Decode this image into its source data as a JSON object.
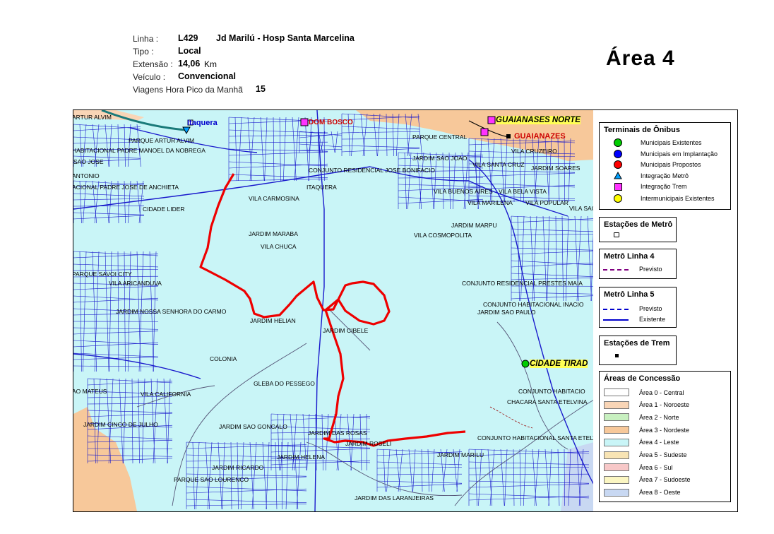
{
  "header": {
    "linha_label": "Linha :",
    "linha_code": "L429",
    "linha_name": "Jd Marilú - Hosp Santa Marcelina",
    "tipo_label": "Tipo :",
    "tipo_value": "Local",
    "extensao_label": "Extensão :",
    "extensao_value": "14,06",
    "extensao_unit": "Km",
    "veiculo_label": "Veículo :",
    "veiculo_value": "Convencional",
    "viagens_label": "Viagens Hora Pico da Manhã",
    "viagens_value": "15",
    "area_title": "Área  4"
  },
  "map": {
    "stations": {
      "itaquera": "Itaquera",
      "dom_bosco": "DOM BOSCO",
      "guaianases_norte": "GUAIANASES NORTE",
      "guaianazes": "GUAIANAZES",
      "cidade_tiradentes": "CIDADE TIRAD"
    },
    "labels": [
      "ARTUR ALVIM",
      "PARQUE ARTUR ALVIM",
      "HABITACIONAL PADRE MANOEL DA NOBREGA",
      "SAO JOSE",
      "ANTONIO",
      "ACIONAL PADRE JOSE DE ANCHIETA",
      "CIDADE LIDER",
      "VILA CARMOSINA",
      "ITAQUERA",
      "CONJUNTO RESIDENCIAL JOSE BONIFACIO",
      "PARQUE CENTRAL",
      "JARDIM SAO JOAO",
      "VILA CRUZEIRO",
      "VILA SANTA CRUZ",
      "JARDIM SOARES",
      "VILA BUENOS AIRES",
      "VILA BELA VISTA",
      "VILA MARILENA",
      "VILA POPULAR",
      "VILA SAO",
      "JARDIM MARPU",
      "VILA COSMOPOLITA",
      "JARDIM MARABA",
      "VILA CHUCA",
      "PARQUE SAVOI CITY",
      "VILA ARICANDUVA",
      "CONJUNTO RESIDENCIAL PRESTES MAIA",
      "JARDIM NOSSA SENHORA DO CARMO",
      "CONJUNTO HABITACIONAL INACIO",
      "JARDIM SAO PAULO",
      "JARDIM HELIAN",
      "JARDIM CIBELE",
      "COLONIA",
      "GLEBA DO PESSEGO",
      "AO MATEUS",
      "VILA CALIFORNIA",
      "CONJUNTO HABITACIO",
      "CHACARA SANTA ETELVINA",
      "JARDIM CINCO DE JULHO",
      "JARDIM SAO GONCALO",
      "JARDIM DAS ROSAS",
      "JARDIM ROSELI",
      "CONJUNTO HABITACIONAL SANTA ETELVINA",
      "JARDIM MARILU",
      "JARDIM HELENA",
      "JARDIM RICARDO",
      "PARQUE SAO LOURENCO",
      "JARDIM DAS LARANJEIRAS"
    ]
  },
  "legend": {
    "terminais": {
      "title": "Terminais de Ônibus",
      "items": [
        {
          "label": "Municipais Existentes",
          "color": "#00cc00"
        },
        {
          "label": "Municipais em Implantação",
          "color": "#0000ff"
        },
        {
          "label": "Municipais Propostos",
          "color": "#ff0000"
        },
        {
          "label": "Integração Metrô",
          "color": "#00a0ff"
        },
        {
          "label": "Integração Trem",
          "color": "#ff33ff"
        },
        {
          "label": "Intermunicipais Existentes",
          "color": "#ffff00"
        }
      ]
    },
    "estacoes_metro": {
      "title": "Estações de Metrô"
    },
    "metro4": {
      "title": "Metrô Linha 4",
      "previsto": "Previsto",
      "color": "#800080"
    },
    "metro5": {
      "title": "Metrô Linha 5",
      "previsto": "Previsto",
      "existente": "Existente",
      "color": "#0000cc"
    },
    "estacoes_trem": {
      "title": "Estações de Trem"
    },
    "areas": {
      "title": "Áreas de Concessão",
      "items": [
        {
          "label": "Área 0 - Central",
          "color": "#ffffff"
        },
        {
          "label": "Área 1 - Noroeste",
          "color": "#f9d5b6"
        },
        {
          "label": "Área 2 - Norte",
          "color": "#c8f0c0"
        },
        {
          "label": "Área 3 - Nordeste",
          "color": "#f7c89a"
        },
        {
          "label": "Área 4 - Leste",
          "color": "#c9f5f7"
        },
        {
          "label": "Área 5 - Sudeste",
          "color": "#f8e4b4"
        },
        {
          "label": "Área 6 - Sul",
          "color": "#f7c8c8"
        },
        {
          "label": "Área 7 - Sudoeste",
          "color": "#fbf6c2"
        },
        {
          "label": "Área 8 - Oeste",
          "color": "#c8d8f2"
        }
      ]
    }
  },
  "colors": {
    "route": "#ee0000",
    "street": "#1a1acc",
    "water": "#555577",
    "area4": "#c9f5f7",
    "area3": "#f7c89a"
  }
}
